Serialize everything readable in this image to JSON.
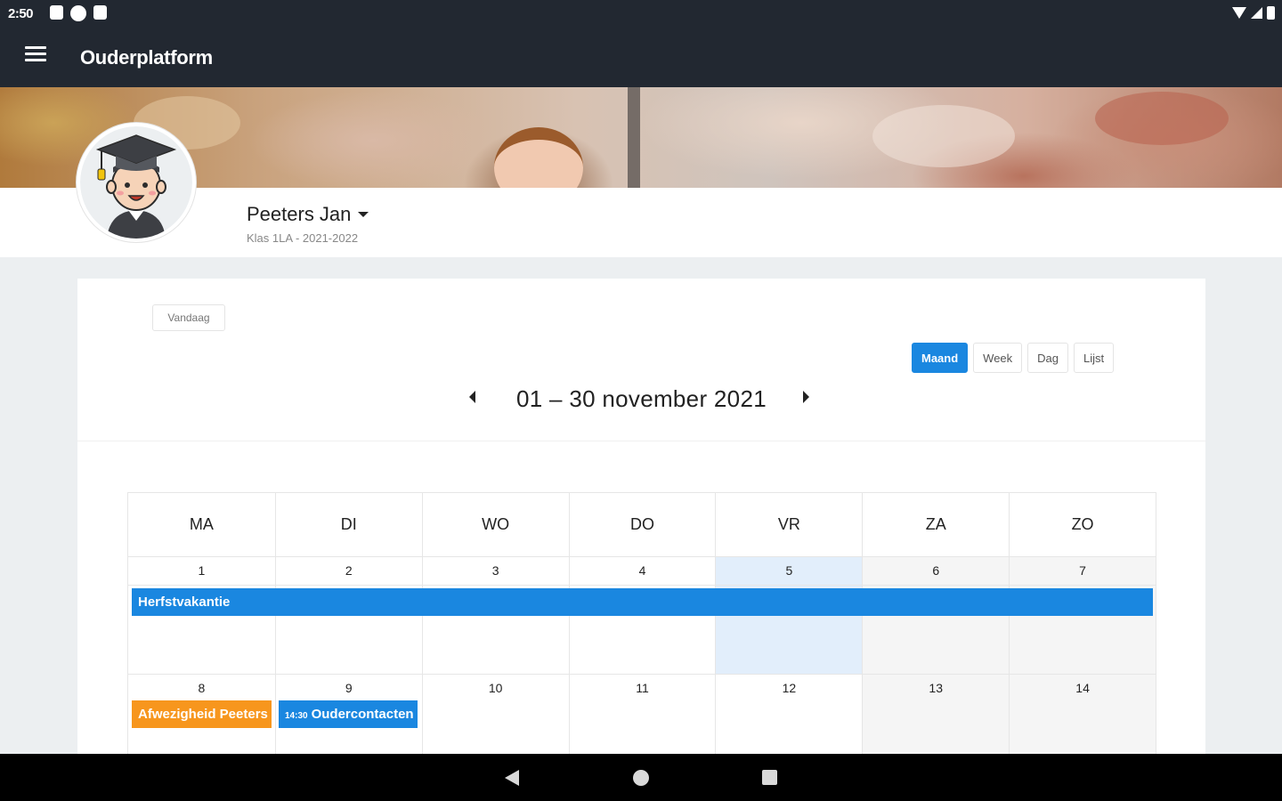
{
  "status_bar": {
    "time": "2:50",
    "icons": [
      "notification-icon",
      "sync-icon",
      "sd-card-icon",
      "wifi-icon",
      "signal-icon",
      "battery-icon"
    ]
  },
  "app_bar": {
    "title": "Ouderplatform",
    "menu_icon": "hamburger-menu-icon",
    "background": "#222831"
  },
  "profile": {
    "name": "Peeters Jan",
    "class_label": "Klas 1LA",
    "separator": " - ",
    "school_year": "2021-2022",
    "avatar_icon": "graduate-avatar-icon"
  },
  "calendar": {
    "today_label": "Vandaag",
    "views": [
      {
        "label": "Maand",
        "active": true
      },
      {
        "label": "Week",
        "active": false
      },
      {
        "label": "Dag",
        "active": false
      },
      {
        "label": "Lijst",
        "active": false
      }
    ],
    "range_title": "01 – 30 november 2021",
    "weekdays": [
      "MA",
      "DI",
      "WO",
      "DO",
      "VR",
      "ZA",
      "ZO"
    ],
    "weeks": [
      {
        "days": [
          "1",
          "2",
          "3",
          "4",
          "5",
          "6",
          "7"
        ]
      },
      {
        "days": [
          "8",
          "9",
          "10",
          "11",
          "12",
          "13",
          "14"
        ]
      }
    ],
    "today_date": "5",
    "events": {
      "herfstvakantie": {
        "title": "Herfstvakantie",
        "color": "#1a87e0"
      },
      "afwezigheid": {
        "title": "Afwezigheid Peeters",
        "color": "#f7961d"
      },
      "oudercontact": {
        "time": "14:30",
        "title": "Oudercontacten",
        "color": "#1a87e0"
      }
    },
    "accent": "#1a87e0"
  },
  "system_nav": {
    "buttons": [
      "back-icon",
      "home-icon",
      "recent-apps-icon"
    ]
  }
}
